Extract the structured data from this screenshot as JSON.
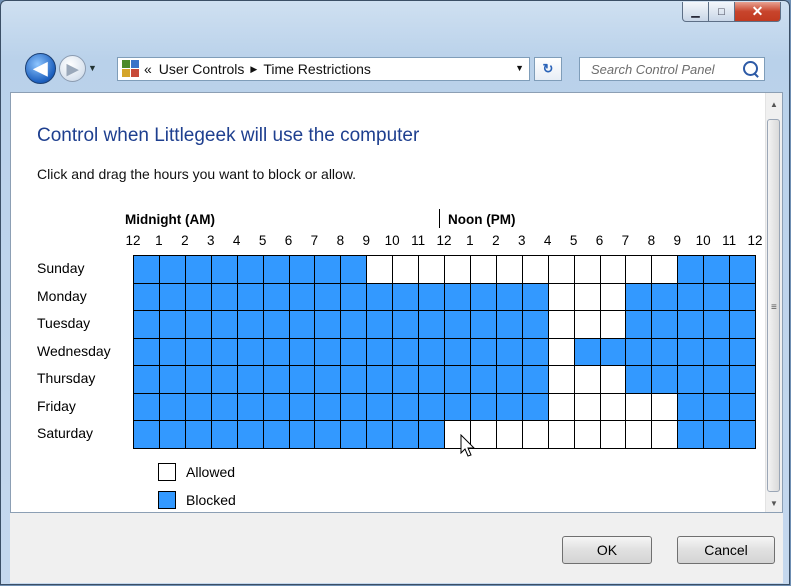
{
  "window": {
    "minimize_label": "▁",
    "maximize_label": "□",
    "close_label": "✕"
  },
  "navigation": {
    "back_arrow": "◀",
    "forward_arrow": "▶",
    "dropdown_arrow": "▼",
    "breadcrumb_prefix": "«",
    "breadcrumb": [
      "User Controls",
      "Time Restrictions"
    ],
    "breadcrumb_separator": "▶",
    "refresh_glyph": "↻",
    "search_placeholder": "Search Control Panel"
  },
  "content": {
    "heading": "Control when Littlegeek will use the computer",
    "instruction": "Click and drag the hours you want to block or allow.",
    "midnight_label": "Midnight (AM)",
    "noon_label": "Noon (PM)",
    "hour_labels": [
      "12",
      "1",
      "2",
      "3",
      "4",
      "5",
      "6",
      "7",
      "8",
      "9",
      "10",
      "11",
      "12",
      "1",
      "2",
      "3",
      "4",
      "5",
      "6",
      "7",
      "8",
      "9",
      "10",
      "11",
      "12"
    ],
    "days": [
      "Sunday",
      "Monday",
      "Tuesday",
      "Wednesday",
      "Thursday",
      "Friday",
      "Saturday"
    ],
    "schedule": [
      [
        "B",
        "B",
        "B",
        "B",
        "B",
        "B",
        "B",
        "B",
        "B",
        "A",
        "A",
        "A",
        "A",
        "A",
        "A",
        "A",
        "A",
        "A",
        "A",
        "A",
        "A",
        "B",
        "B",
        "B"
      ],
      [
        "B",
        "B",
        "B",
        "B",
        "B",
        "B",
        "B",
        "B",
        "B",
        "B",
        "B",
        "B",
        "B",
        "B",
        "B",
        "B",
        "A",
        "A",
        "A",
        "B",
        "B",
        "B",
        "B",
        "B"
      ],
      [
        "B",
        "B",
        "B",
        "B",
        "B",
        "B",
        "B",
        "B",
        "B",
        "B",
        "B",
        "B",
        "B",
        "B",
        "B",
        "B",
        "A",
        "A",
        "A",
        "B",
        "B",
        "B",
        "B",
        "B"
      ],
      [
        "B",
        "B",
        "B",
        "B",
        "B",
        "B",
        "B",
        "B",
        "B",
        "B",
        "B",
        "B",
        "B",
        "B",
        "B",
        "B",
        "A",
        "B",
        "B",
        "B",
        "B",
        "B",
        "B",
        "B"
      ],
      [
        "B",
        "B",
        "B",
        "B",
        "B",
        "B",
        "B",
        "B",
        "B",
        "B",
        "B",
        "B",
        "B",
        "B",
        "B",
        "B",
        "A",
        "A",
        "A",
        "B",
        "B",
        "B",
        "B",
        "B"
      ],
      [
        "B",
        "B",
        "B",
        "B",
        "B",
        "B",
        "B",
        "B",
        "B",
        "B",
        "B",
        "B",
        "B",
        "B",
        "B",
        "B",
        "A",
        "A",
        "A",
        "A",
        "A",
        "B",
        "B",
        "B"
      ],
      [
        "B",
        "B",
        "B",
        "B",
        "B",
        "B",
        "B",
        "B",
        "B",
        "B",
        "B",
        "B",
        "A",
        "A",
        "A",
        "A",
        "A",
        "A",
        "A",
        "A",
        "A",
        "B",
        "B",
        "B"
      ]
    ],
    "legend": {
      "allowed_label": "Allowed",
      "blocked_label": "Blocked"
    },
    "colors": {
      "blocked": "#3399ff",
      "allowed": "#ffffff",
      "heading": "#1e3f8f"
    }
  },
  "scrollbar": {
    "up_arrow": "▲",
    "down_arrow": "▼",
    "grip": "≡"
  },
  "footer": {
    "ok_label": "OK",
    "cancel_label": "Cancel"
  }
}
